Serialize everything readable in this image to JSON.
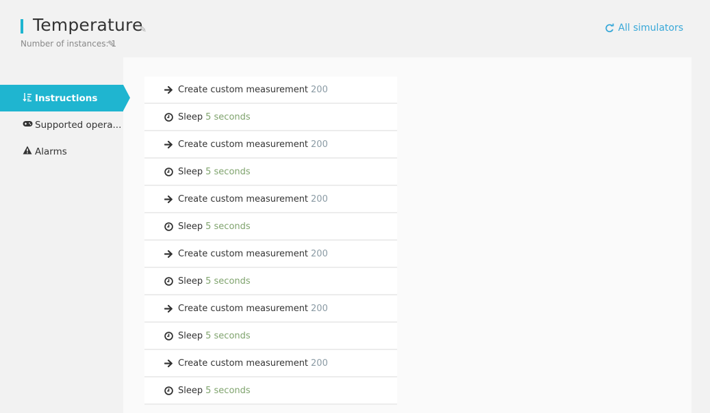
{
  "header": {
    "title": "Temperature",
    "instances_label": "Number of instances: 1",
    "all_simulators": "All simulators"
  },
  "sidebar": {
    "items": [
      {
        "label": "Instructions",
        "icon": "sort-list-icon",
        "active": true
      },
      {
        "label": "Supported opera...",
        "icon": "gamepad-icon",
        "active": false
      },
      {
        "label": "Alarms",
        "icon": "warning-icon",
        "active": false
      }
    ]
  },
  "instructions": [
    {
      "type": "measurement",
      "label": "Create custom measurement",
      "value": "200",
      "icon": "arrow-right-icon"
    },
    {
      "type": "sleep",
      "label": "Sleep",
      "value": "5 seconds",
      "icon": "clock-icon"
    },
    {
      "type": "measurement",
      "label": "Create custom measurement",
      "value": "200",
      "icon": "arrow-right-icon"
    },
    {
      "type": "sleep",
      "label": "Sleep",
      "value": "5 seconds",
      "icon": "clock-icon"
    },
    {
      "type": "measurement",
      "label": "Create custom measurement",
      "value": "200",
      "icon": "arrow-right-icon"
    },
    {
      "type": "sleep",
      "label": "Sleep",
      "value": "5 seconds",
      "icon": "clock-icon"
    },
    {
      "type": "measurement",
      "label": "Create custom measurement",
      "value": "200",
      "icon": "arrow-right-icon"
    },
    {
      "type": "sleep",
      "label": "Sleep",
      "value": "5 seconds",
      "icon": "clock-icon"
    },
    {
      "type": "measurement",
      "label": "Create custom measurement",
      "value": "200",
      "icon": "arrow-right-icon"
    },
    {
      "type": "sleep",
      "label": "Sleep",
      "value": "5 seconds",
      "icon": "clock-icon"
    },
    {
      "type": "measurement",
      "label": "Create custom measurement",
      "value": "200",
      "icon": "arrow-right-icon"
    },
    {
      "type": "sleep",
      "label": "Sleep",
      "value": "5 seconds",
      "icon": "clock-icon"
    }
  ],
  "colors": {
    "accent": "#1fb5d0",
    "link": "#38a8d8",
    "value_muted": "#8a9aa4",
    "sleep_value": "#7fa36d"
  }
}
